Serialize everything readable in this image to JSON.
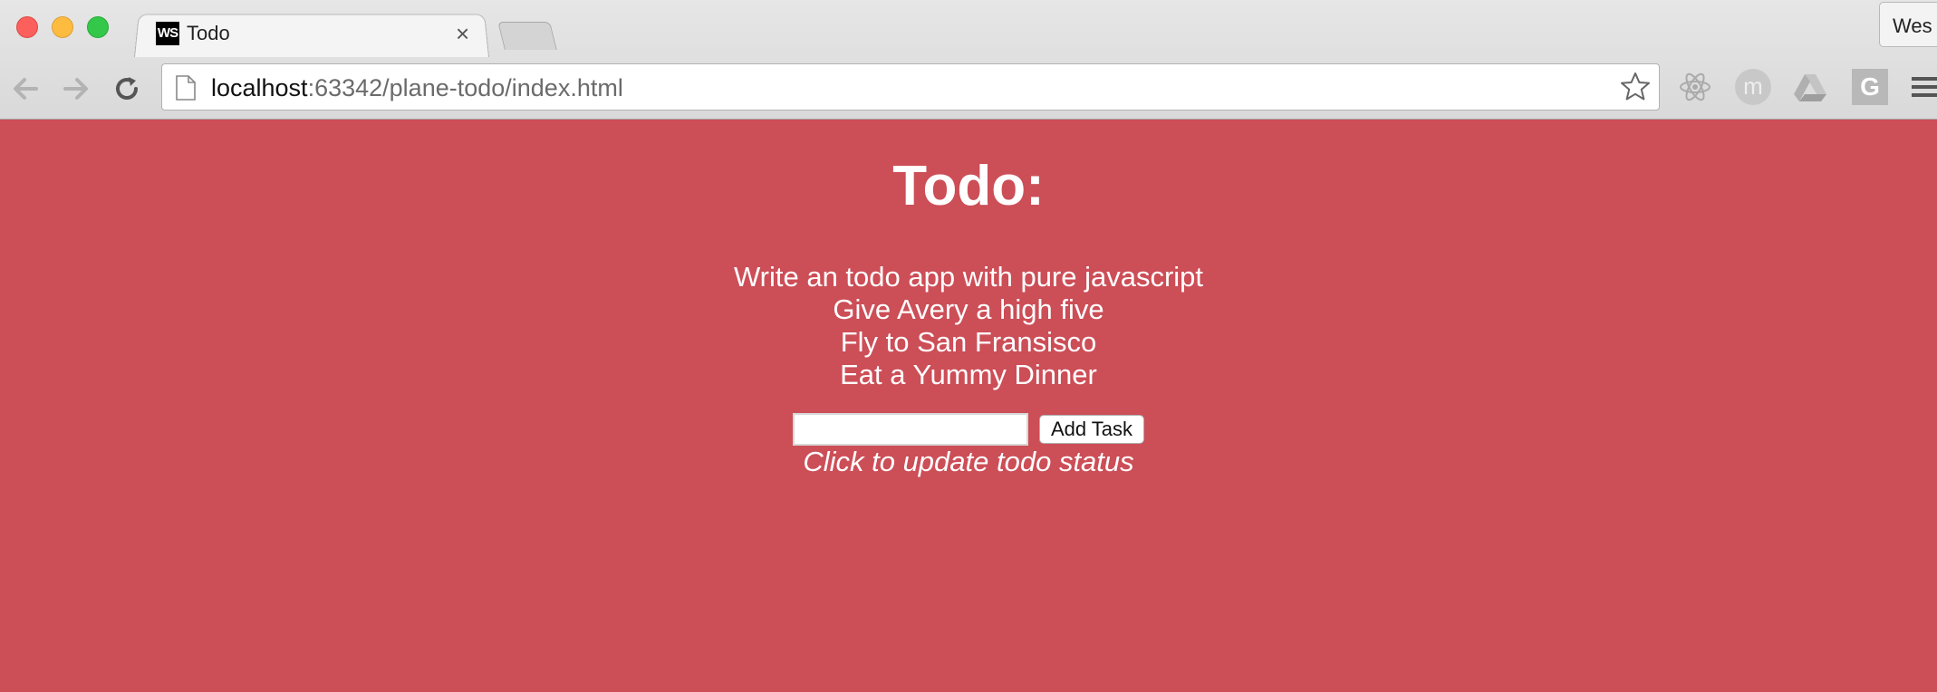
{
  "browser": {
    "tab_icon_text": "WS",
    "tab_title": "Todo",
    "tab_close": "×",
    "profile_label": "Wes",
    "url_host": "localhost",
    "url_path": ":63342/plane-todo/index.html",
    "extension_icons": [
      "react-icon",
      "m-icon",
      "drive-icon",
      "g-icon"
    ],
    "extension_m_label": "m",
    "extension_g_label": "G"
  },
  "page": {
    "background": "#cc4e57",
    "title": "Todo:",
    "todos": [
      "Write an todo app with pure javascript",
      "Give Avery a high five",
      "Fly to San Fransisco",
      "Eat a Yummy Dinner"
    ],
    "input_value": "",
    "add_button_label": "Add Task",
    "hint": "Click to update todo status"
  }
}
